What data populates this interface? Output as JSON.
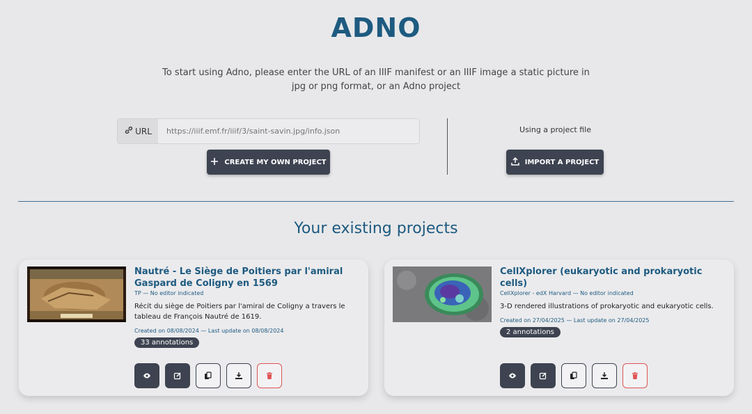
{
  "header": {
    "logo": "ADNO",
    "intro": "To start using Adno, please enter the URL of an IIIF manifest or an IIIF image a static picture in jpg or png format, or an Adno project"
  },
  "url_form": {
    "prefix_label": "URL",
    "placeholder": "https://iiif.emf.fr/iiif/3/saint-savin.jpg/info.json",
    "create_label": "CREATE MY OWN PROJECT"
  },
  "import": {
    "label": "Using a project file",
    "button_label": "IMPORT A PROJECT"
  },
  "projects": {
    "section_title": "Your existing projects",
    "items": [
      {
        "title": "Nautré - Le Siège de Poitiers par l'amiral Gaspard de Coligny en 1569",
        "meta": "TP — No editor indicated",
        "description": "Récit du siège de Poitiers par l'amiral de Coligny a travers le tableau de François Nautré de 1619.",
        "dates": "Created on 08/08/2024 — Last update on 08/08/2024",
        "annotations": "33 annotations"
      },
      {
        "title": "CellXplorer (eukaryotic and prokaryotic cells)",
        "meta": "CellXplorer - edX Harvard — No editor indicated",
        "description": "3-D rendered illustrations of prokaryotic and eukaryotic cells.",
        "dates": "Created on 27/04/2025 — Last update on 27/04/2025",
        "annotations": "2 annotations"
      }
    ]
  },
  "icons": {
    "link": "link-icon",
    "plus": "plus-icon",
    "upload": "upload-icon",
    "view": "eye-icon",
    "edit": "edit-icon",
    "duplicate": "copy-icon",
    "download": "download-icon",
    "delete": "trash-icon"
  },
  "colors": {
    "brand": "#1e5a80",
    "dark_button": "#3d4350",
    "danger": "#e05555",
    "background": "#e8e8ea"
  }
}
